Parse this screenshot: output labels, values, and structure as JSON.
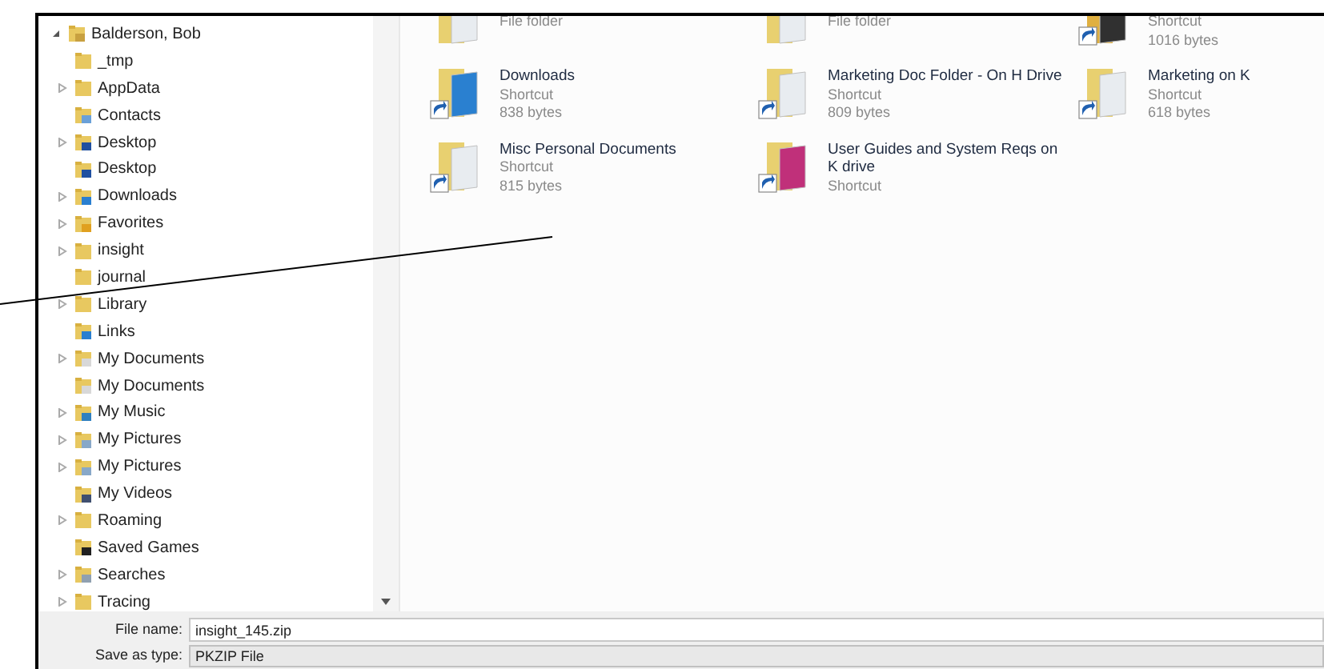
{
  "tree": [
    {
      "label": "Balderson, Bob",
      "kind": "user",
      "expanded": true,
      "children": [
        {
          "label": "_tmp",
          "kind": "folder"
        },
        {
          "label": "AppData",
          "kind": "folder",
          "expanded": false
        },
        {
          "label": "Contacts",
          "kind": "contacts"
        },
        {
          "label": "Desktop",
          "kind": "desktop",
          "expanded": false
        },
        {
          "label": "Desktop",
          "kind": "desktop"
        },
        {
          "label": "Downloads",
          "kind": "downloads",
          "expanded": false
        },
        {
          "label": "Favorites",
          "kind": "favorites",
          "expanded": false
        },
        {
          "label": "insight",
          "kind": "folder",
          "expanded": false
        },
        {
          "label": "journal",
          "kind": "folder"
        },
        {
          "label": "Library",
          "kind": "folder",
          "expanded": false
        },
        {
          "label": "Links",
          "kind": "links"
        },
        {
          "label": "My Documents",
          "kind": "documents",
          "expanded": false
        },
        {
          "label": "My Documents",
          "kind": "documents"
        },
        {
          "label": "My Music",
          "kind": "music",
          "expanded": false
        },
        {
          "label": "My Pictures",
          "kind": "pictures",
          "expanded": false
        },
        {
          "label": "My Pictures",
          "kind": "pictures",
          "expanded": false
        },
        {
          "label": "My Videos",
          "kind": "videos"
        },
        {
          "label": "Roaming",
          "kind": "folder",
          "expanded": false
        },
        {
          "label": "Saved Games",
          "kind": "games"
        },
        {
          "label": "Searches",
          "kind": "searches",
          "expanded": false
        },
        {
          "label": "Tracing",
          "kind": "folder",
          "expanded": false
        }
      ]
    }
  ],
  "files": [
    {
      "lines": [
        "File folder"
      ],
      "kind": "docs-folder",
      "shortcut": false
    },
    {
      "lines": [
        "File folder"
      ],
      "kind": "docs-folder",
      "shortcut": false
    },
    {
      "lines": [
        "Shortcut",
        "1016 bytes"
      ],
      "kind": "dark-folder",
      "shortcut": true
    },
    {
      "name": "Downloads",
      "lines": [
        "Shortcut",
        "838 bytes"
      ],
      "kind": "downloads-folder",
      "shortcut": true
    },
    {
      "name": "Marketing Doc Folder - On H Drive",
      "lines": [
        "Shortcut",
        "809 bytes"
      ],
      "kind": "docs-folder",
      "shortcut": true
    },
    {
      "name": "Marketing on K",
      "lines": [
        "Shortcut",
        "618 bytes"
      ],
      "kind": "docs-folder",
      "shortcut": true
    },
    {
      "name": "Misc Personal Documents",
      "lines": [
        "Shortcut",
        "815 bytes"
      ],
      "kind": "docs-folder",
      "shortcut": true
    },
    {
      "name": "User Guides and System Reqs on K drive",
      "lines": [
        "Shortcut"
      ],
      "kind": "pink-folder",
      "shortcut": true
    }
  ],
  "file_name": {
    "label": "File name:",
    "value": "insight_145.zip"
  },
  "save_as_type": {
    "label": "Save as type:",
    "value": "PKZIP File"
  }
}
